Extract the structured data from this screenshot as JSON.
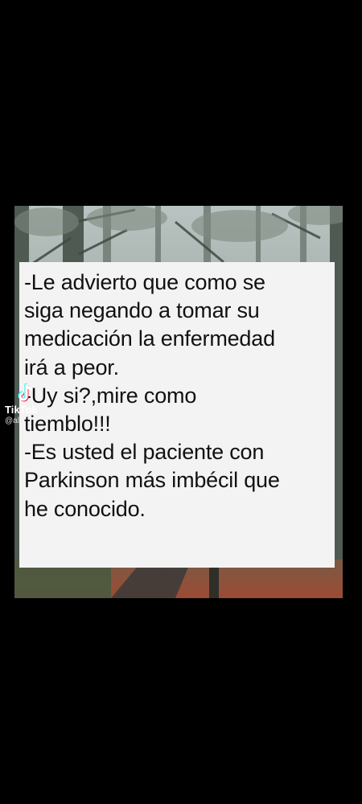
{
  "photo": {
    "description_icon": "forest-photo-icon"
  },
  "quote": {
    "lines": [
      "-Le advierto que como se",
      "siga negando a tomar su",
      "medicación la enfermedad",
      "irá a peor.",
      "-Uy si?,mire como",
      "tiemblo!!!",
      "-Es usted el paciente con",
      "Parkinson más imbécil que",
      "he conocido."
    ]
  },
  "watermark": {
    "brand": "TikTok",
    "handle": "@al",
    "icon": "tiktok-logo-icon"
  },
  "colors": {
    "background": "#000000",
    "card": "#f4f3f3",
    "text": "#111111"
  }
}
